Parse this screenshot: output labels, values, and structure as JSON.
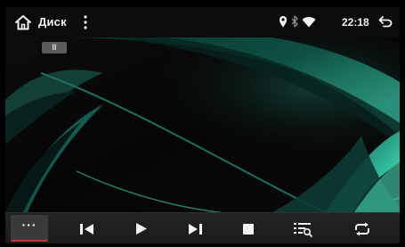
{
  "statusbar": {
    "title": "Диск",
    "time": "22:18",
    "icons": [
      "home-icon",
      "menu-dots-icon",
      "location-icon",
      "bluetooth-icon",
      "wifi-icon",
      "back-icon"
    ]
  },
  "player": {
    "state_badge": "II"
  },
  "controls": {
    "more_label": "···",
    "buttons": [
      "more-icon",
      "previous-icon",
      "play-icon",
      "next-icon",
      "stop-icon",
      "playlist-search-icon",
      "repeat-icon"
    ]
  },
  "colors": {
    "accent_red": "#c0343a",
    "wave_teal": "#2fb59a"
  }
}
